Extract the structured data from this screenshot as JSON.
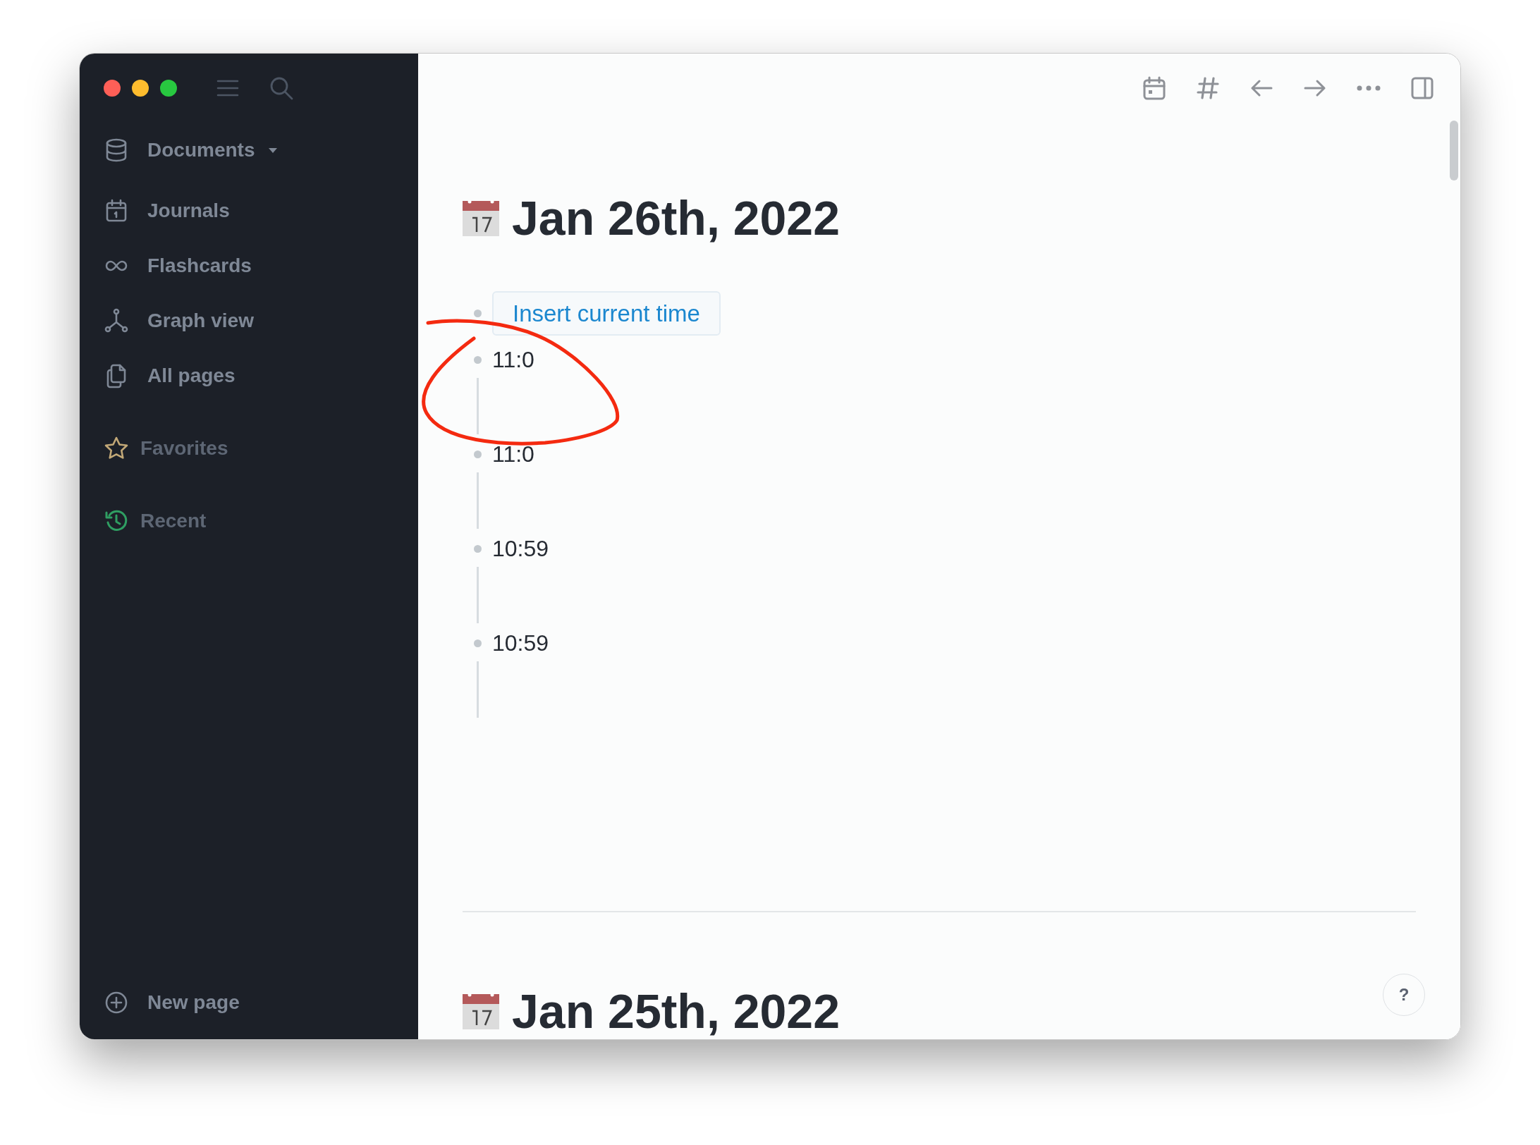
{
  "sidebar": {
    "items": [
      {
        "label": "Documents",
        "kind": "dropdown"
      },
      {
        "label": "Journals",
        "kind": "nav"
      },
      {
        "label": "Flashcards",
        "kind": "nav"
      },
      {
        "label": "Graph view",
        "kind": "nav"
      },
      {
        "label": "All pages",
        "kind": "nav"
      },
      {
        "label": "Favorites",
        "kind": "section"
      },
      {
        "label": "Recent",
        "kind": "section"
      }
    ],
    "new_page": "New page"
  },
  "journals": [
    {
      "title": "Jan 26th, 2022",
      "blocks": [
        {
          "kind": "command",
          "text": "Insert current time"
        },
        {
          "kind": "text",
          "text": "11:0"
        },
        {
          "kind": "text",
          "text": "11:0"
        },
        {
          "kind": "text",
          "text": "10:59"
        },
        {
          "kind": "text",
          "text": "10:59"
        }
      ]
    },
    {
      "title": "Jan 25th, 2022"
    }
  ],
  "help_button": "?"
}
